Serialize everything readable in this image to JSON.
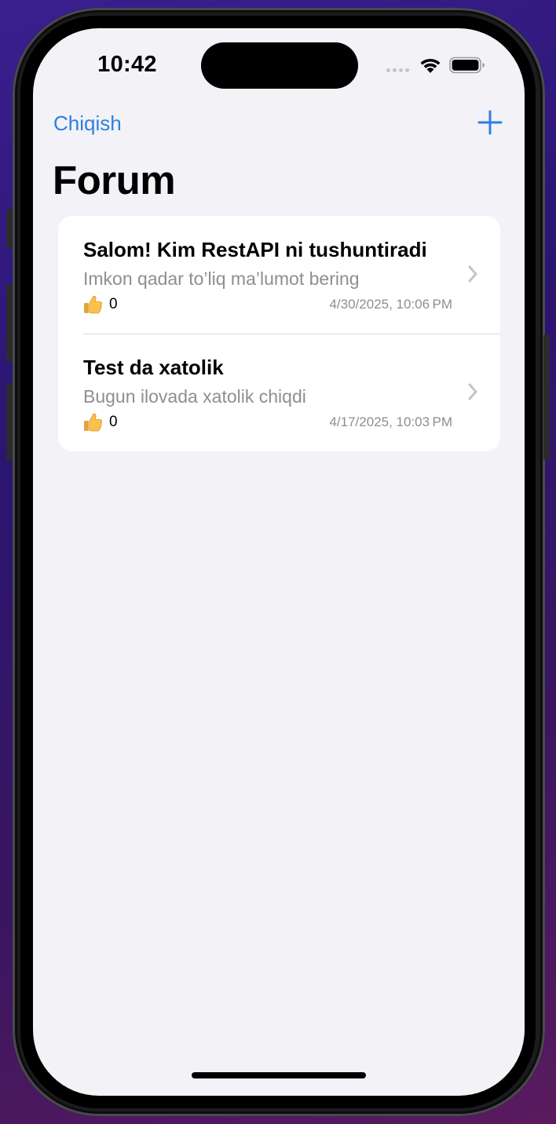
{
  "status_bar": {
    "time": "10:42",
    "icons": [
      "cellular-signal-icon",
      "wifi-icon",
      "battery-icon"
    ]
  },
  "nav": {
    "left_label": "Chiqish",
    "right_icon": "plus-icon",
    "title": "Forum"
  },
  "colors": {
    "accent": "#2f7fe0",
    "background": "#f2f2f7",
    "secondary_text": "#8e8e93"
  },
  "posts": [
    {
      "title": "Salom! Kim RestAPI ni tushuntiradi",
      "subtitle": "Imkon qadar to’liq ma’lumot bering",
      "likes": "0",
      "date": "4/30/2025, 10:06 PM"
    },
    {
      "title": "Test da xatolik",
      "subtitle": "Bugun ilovada xatolik chiqdi",
      "likes": "0",
      "date": "4/17/2025, 10:03 PM"
    }
  ]
}
